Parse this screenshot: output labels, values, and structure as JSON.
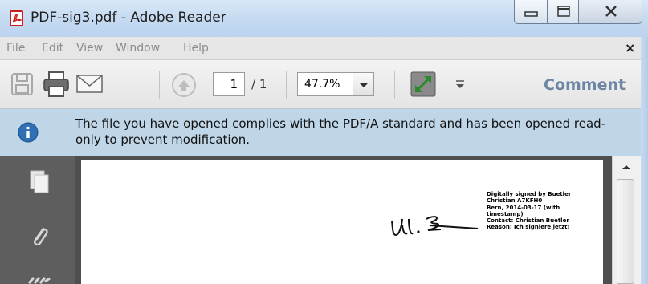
{
  "window": {
    "title": "PDF-sig3.pdf - Adobe Reader",
    "app_icon": "adobe-reader-icon",
    "controls": [
      "minimize-icon",
      "maximize-icon",
      "close-icon"
    ]
  },
  "menu": {
    "items": [
      "File",
      "Edit",
      "View",
      "Window",
      "Help"
    ],
    "close_label": "×"
  },
  "toolbar": {
    "page_current": "1",
    "page_total": "/ 1",
    "zoom": "47.7%",
    "comment_label": "Comment",
    "icons": [
      "save-icon",
      "print-icon",
      "email-icon",
      "page-up-icon",
      "zoom-dropdown-icon",
      "full-screen-icon",
      "toolbar-overflow-icon"
    ]
  },
  "infobar": {
    "icon": "info-icon",
    "message": "The file you have opened complies with the PDF/A standard and has been opened read-only to prevent modification."
  },
  "navpane": {
    "icons": [
      "pages-icon",
      "attachments-icon",
      "signatures-icon"
    ]
  },
  "document": {
    "signature_lines": [
      "Digitally signed by Buetler",
      "Christian A7KFH0",
      "Bern, 2014-03-17 (with",
      "timestamp)",
      "Contact: Christian Buetler",
      "Reason: Ich signiere jetzt!"
    ]
  },
  "colors": {
    "titlebar": "#c7dcf2",
    "infobar": "#bfd6e8",
    "comment_text": "#6e86a5",
    "navpane": "#5e5e5e",
    "doc_background": "#4f4f4f"
  }
}
